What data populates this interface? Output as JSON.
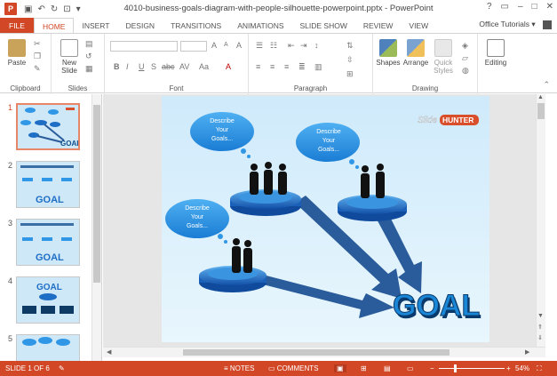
{
  "app": {
    "logo_letter": "P",
    "title": "4010-business-goals-diagram-with-people-silhouette-powerpoint.pptx - PowerPoint",
    "window_controls": [
      "?",
      "▭",
      "–",
      "□",
      "✕"
    ],
    "account": "Office Tutorials",
    "account_arrow": "▾",
    "accent": "#d24726"
  },
  "tabs": [
    "FILE",
    "HOME",
    "INSERT",
    "DESIGN",
    "TRANSITIONS",
    "ANIMATIONS",
    "SLIDE SHOW",
    "REVIEW",
    "VIEW"
  ],
  "active_tab": "HOME",
  "ribbon": {
    "clipboard": {
      "label": "Clipboard",
      "paste": "Paste"
    },
    "slides": {
      "label": "Slides",
      "new_slide_1": "New",
      "new_slide_2": "Slide"
    },
    "font": {
      "label": "Font",
      "bold": "B",
      "italic": "I",
      "underline": "U",
      "strike": "S",
      "abc": "abc",
      "spacing": "AV",
      "grow": "A",
      "shrink": "A",
      "case": "Aa",
      "clear": "A",
      "color": "A"
    },
    "paragraph": {
      "label": "Paragraph"
    },
    "drawing": {
      "label": "Drawing",
      "shapes": "Shapes",
      "arrange": "Arrange",
      "quick_1": "Quick",
      "quick_2": "Styles"
    },
    "editing": {
      "label": "Editing"
    }
  },
  "thumbnails": [
    {
      "num": "1",
      "selected": true
    },
    {
      "num": "2",
      "selected": false,
      "caption": "GOAL"
    },
    {
      "num": "3",
      "selected": false,
      "caption": "GOAL"
    },
    {
      "num": "4",
      "selected": false,
      "caption": "GOAL"
    },
    {
      "num": "5",
      "selected": false
    }
  ],
  "slide": {
    "bubble_text": [
      "Describe",
      "Your",
      "Goals..."
    ],
    "goal_text": "GOAL",
    "logo_slide": "Slide",
    "logo_hunter": "HUNTER",
    "background": "#d6eefb",
    "cloud_color": "#2f97e6",
    "platform_color": "#1f6ec5",
    "arrow_color": "#2a5b9a"
  },
  "statusbar": {
    "slide_info": "SLIDE 1 OF 6",
    "notes": "NOTES",
    "comments": "COMMENTS",
    "zoom": "54%",
    "zoom_level": 0.54
  }
}
